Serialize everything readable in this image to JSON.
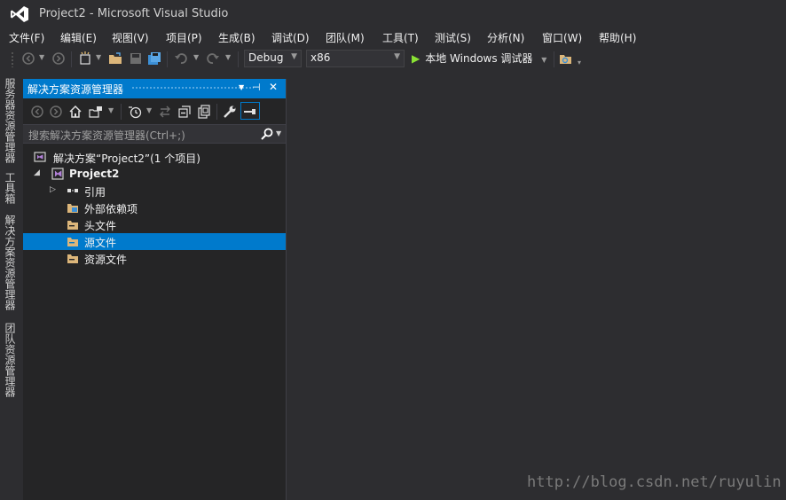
{
  "window": {
    "title": "Project2 - Microsoft Visual Studio"
  },
  "menu": {
    "items": [
      {
        "label": "文件(F)"
      },
      {
        "label": "编辑(E)"
      },
      {
        "label": "视图(V)"
      },
      {
        "label": "项目(P)"
      },
      {
        "label": "生成(B)"
      },
      {
        "label": "调试(D)"
      },
      {
        "label": "团队(M)"
      },
      {
        "label": "工具(T)"
      },
      {
        "label": "测试(S)"
      },
      {
        "label": "分析(N)"
      },
      {
        "label": "窗口(W)"
      },
      {
        "label": "帮助(H)"
      }
    ]
  },
  "toolbar": {
    "configuration": "Debug",
    "platform": "x86",
    "run_label": "本地 Windows 调试器"
  },
  "side_tabs": [
    "服务器资源管理器",
    "工具箱",
    "解决方案资源管理器",
    "团队资源管理器"
  ],
  "solution_explorer": {
    "title": "解决方案资源管理器",
    "search_placeholder": "搜索解决方案资源管理器(Ctrl+;)",
    "solution_label": "解决方案“Project2”(1 个项目)",
    "project_label": "Project2",
    "items": [
      {
        "label": "引用"
      },
      {
        "label": "外部依赖项"
      },
      {
        "label": "头文件"
      },
      {
        "label": "源文件"
      },
      {
        "label": "资源文件"
      }
    ],
    "selected_item": "源文件"
  },
  "colors": {
    "accent": "#007acc",
    "background": "#2d2d30",
    "panel": "#252526",
    "folder": "#dcb67a"
  },
  "watermark": "http://blog.csdn.net/ruyulin"
}
